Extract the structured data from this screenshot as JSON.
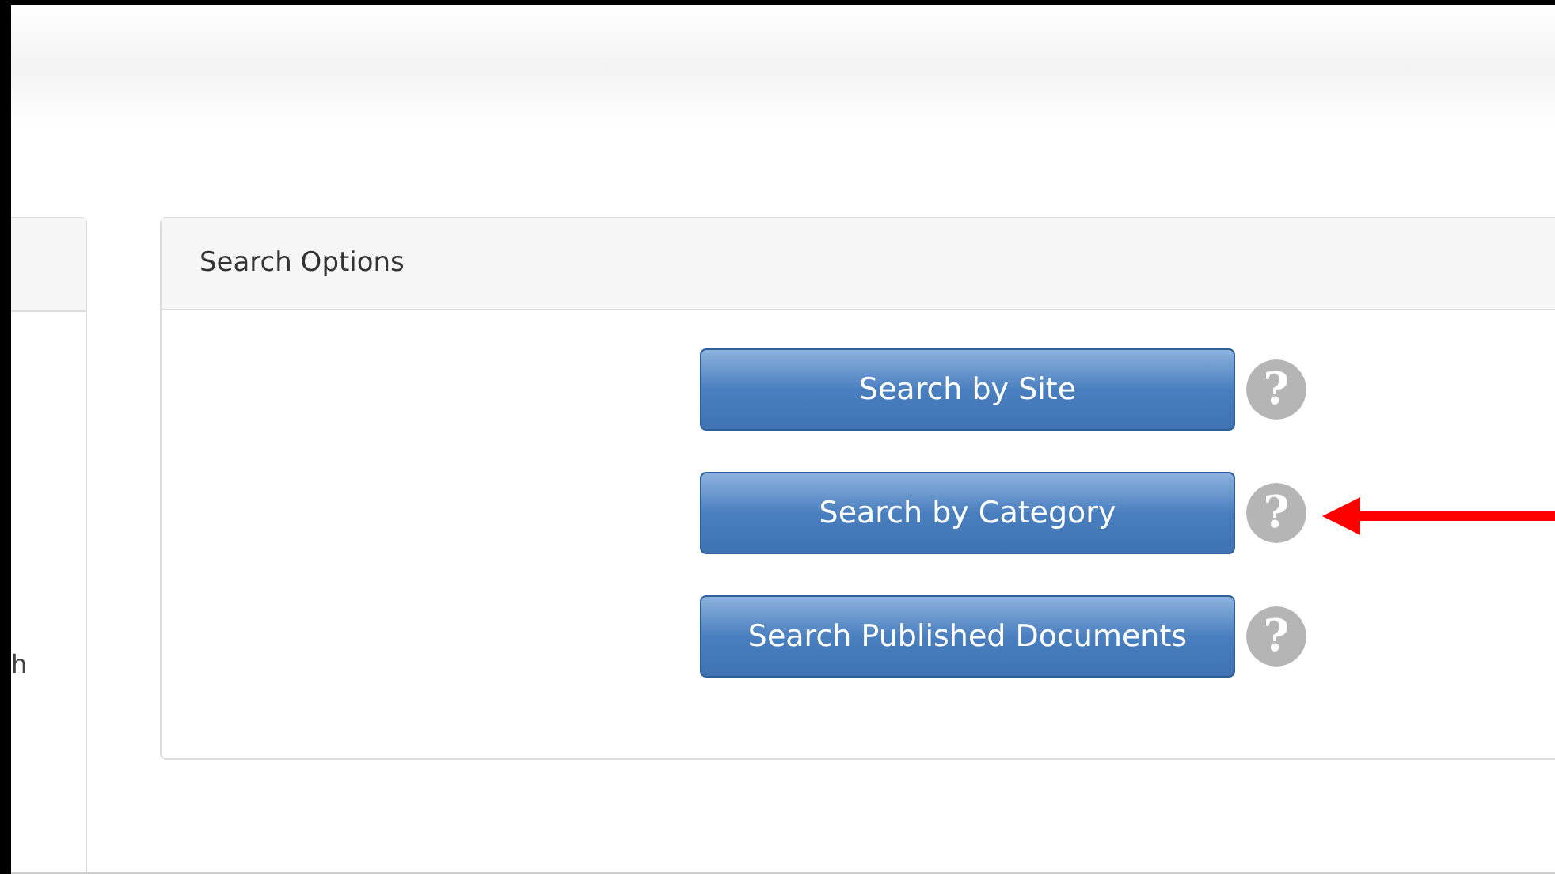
{
  "left_panel": {
    "text": "h"
  },
  "search_options": {
    "title": "Search Options",
    "buttons": [
      {
        "label": "Search by Site"
      },
      {
        "label": "Search by Category"
      },
      {
        "label": "Search Published Documents"
      }
    ]
  },
  "help_glyph": "?"
}
